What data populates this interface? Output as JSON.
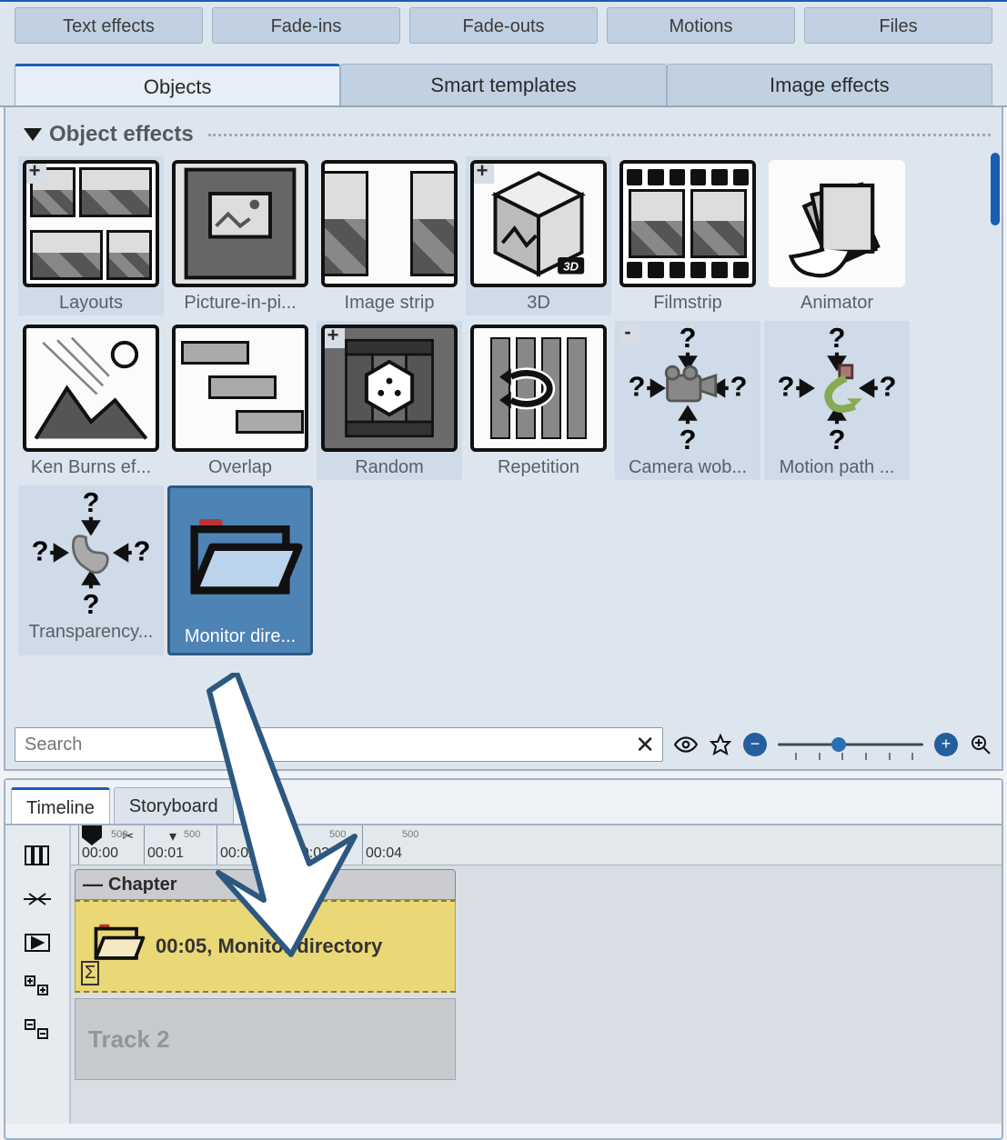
{
  "top_tabs": [
    "Text effects",
    "Fade-ins",
    "Fade-outs",
    "Motions",
    "Files"
  ],
  "second_tabs": [
    {
      "label": "Objects",
      "active": true
    },
    {
      "label": "Smart templates",
      "active": false
    },
    {
      "label": "Image effects",
      "active": false
    }
  ],
  "group_title": "Object effects",
  "effects": [
    {
      "id": "layouts",
      "label": "Layouts",
      "mark": "+"
    },
    {
      "id": "pip",
      "label": "Picture-in-pi..."
    },
    {
      "id": "strip",
      "label": "Image strip"
    },
    {
      "id": "3d",
      "label": "3D",
      "mark": "+"
    },
    {
      "id": "filmstrip",
      "label": "Filmstrip"
    },
    {
      "id": "animator",
      "label": "Animator"
    },
    {
      "id": "kenburns",
      "label": "Ken Burns ef..."
    },
    {
      "id": "overlap",
      "label": "Overlap"
    },
    {
      "id": "random",
      "label": "Random",
      "mark": "+"
    },
    {
      "id": "repetition",
      "label": "Repetition"
    },
    {
      "id": "camwobble",
      "label": "Camera wob...",
      "mark": "-"
    },
    {
      "id": "motionpath",
      "label": "Motion path ..."
    },
    {
      "id": "transparency",
      "label": "Transparency..."
    },
    {
      "id": "monitordir",
      "label": "Monitor dire...",
      "selected": true
    }
  ],
  "search": {
    "placeholder": "Search",
    "value": ""
  },
  "slider_percent": 42,
  "lower_tabs": [
    {
      "label": "Timeline",
      "active": true
    },
    {
      "label": "Storyboard",
      "active": false
    }
  ],
  "ruler": {
    "labels": [
      "00:00",
      "00:01",
      "00:02",
      "00:03",
      "00:04"
    ],
    "sub": "500"
  },
  "chapter_label": "Chapter",
  "clip": {
    "time": "00:05,",
    "name": "Monitor directory"
  },
  "track2_label": "Track 2",
  "colors": {
    "accent": "#1b5db5",
    "select": "#4e83b5",
    "clip": "#ead776"
  }
}
